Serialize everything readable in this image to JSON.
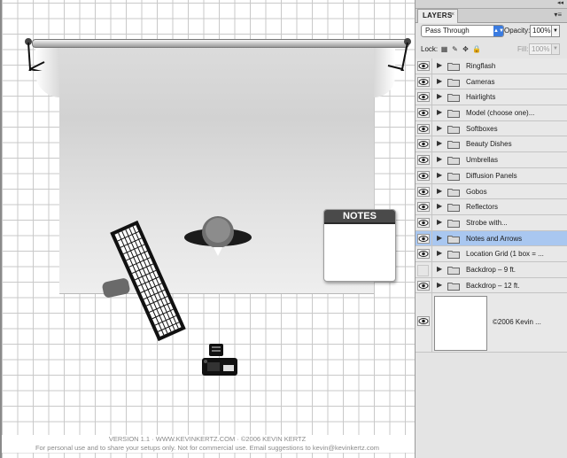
{
  "canvas": {
    "notes_title": "NOTES",
    "credits_line1": "VERSION 1.1  ·  WWW.KEVINKERTZ.COM  ·  ©2006 KEVIN KERTZ",
    "credits_line2": "For personal use and to share your setups only. Not for commercial use.  Email suggestions to kevin@kevinkertz.com"
  },
  "panel": {
    "tab_label": "LAYERS",
    "close_glyph": "×",
    "collapse_glyph": "◂◂",
    "menu_glyph": "▾≡",
    "blend_mode": "Pass Through",
    "opacity_label": "Opacity:",
    "opacity_value": "100%",
    "lock_label": "Lock:",
    "fill_label": "Fill:",
    "fill_value": "100%",
    "layers": [
      {
        "name": "Ringflash",
        "visible": true,
        "selected": false
      },
      {
        "name": "Cameras",
        "visible": true,
        "selected": false
      },
      {
        "name": "Hairlights",
        "visible": true,
        "selected": false
      },
      {
        "name": "Model (choose one)...",
        "visible": true,
        "selected": false
      },
      {
        "name": "Softboxes",
        "visible": true,
        "selected": false
      },
      {
        "name": "Beauty Dishes",
        "visible": true,
        "selected": false
      },
      {
        "name": "Umbrellas",
        "visible": true,
        "selected": false
      },
      {
        "name": "Diffusion Panels",
        "visible": true,
        "selected": false
      },
      {
        "name": "Gobos",
        "visible": true,
        "selected": false
      },
      {
        "name": "Reflectors",
        "visible": true,
        "selected": false
      },
      {
        "name": "Strobe with...",
        "visible": true,
        "selected": false
      },
      {
        "name": "Notes and Arrows",
        "visible": true,
        "selected": true
      },
      {
        "name": "Location Grid (1 box = ...",
        "visible": true,
        "selected": false
      },
      {
        "name": "Backdrop – 9 ft.",
        "visible": false,
        "selected": false
      },
      {
        "name": "Backdrop – 12 ft.",
        "visible": true,
        "selected": false
      }
    ],
    "image_layer_name": "©2006 Kevin ..."
  },
  "colors": {
    "selection": "#a9c7f0",
    "panel_bg": "#e4e4e4",
    "grid": "#c9c9c9"
  }
}
